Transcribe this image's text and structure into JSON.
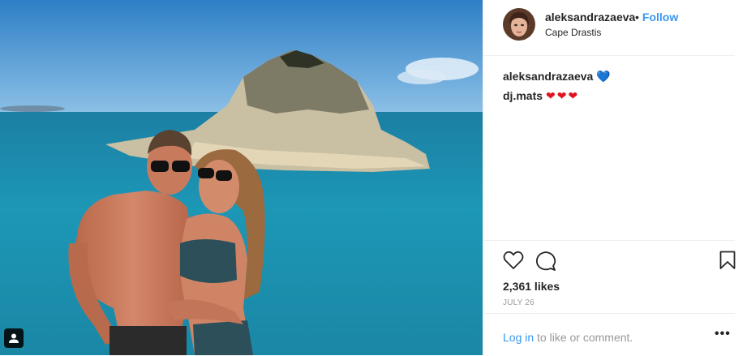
{
  "post": {
    "username": "aleksandrazaeva",
    "follow_separator": "•",
    "follow_label": "Follow",
    "location": "Cape Drastis",
    "comments": [
      {
        "user": "aleksandrazaeva",
        "text": "💙"
      },
      {
        "user": "dj.mats",
        "text": "❤❤❤"
      }
    ],
    "likes": "2,361 likes",
    "date": "July 26",
    "login_link": "Log in",
    "login_suffix": " to like or comment.",
    "more_label": "•••"
  },
  "colors": {
    "link": "#3897f0",
    "text": "#262626",
    "muted": "#999999",
    "divider": "#efefef"
  },
  "icons": {
    "like": "heart-outline-icon",
    "comment": "speech-bubble-icon",
    "save": "bookmark-icon",
    "tag": "user-tag-icon"
  }
}
